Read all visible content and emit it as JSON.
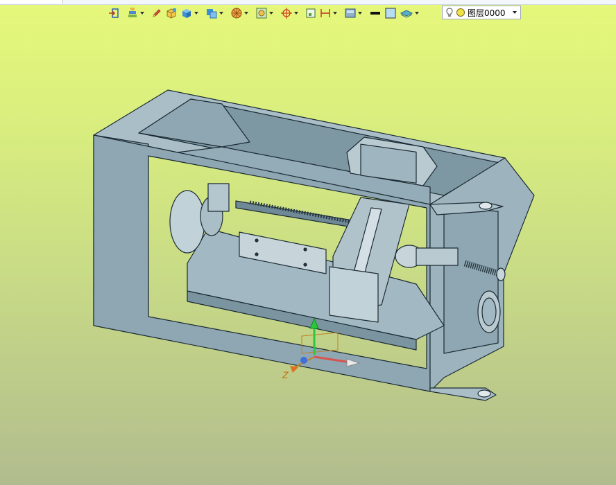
{
  "toolbar": {
    "items": [
      {
        "icon": "import-icon",
        "has_dropdown": false
      },
      {
        "icon": "layers-stack-icon",
        "has_dropdown": true
      },
      {
        "icon": "pencil-sketch-icon",
        "has_dropdown": false
      },
      {
        "icon": "extrude-icon",
        "has_dropdown": false
      },
      {
        "icon": "solid-box-icon",
        "has_dropdown": true
      },
      {
        "icon": "view-cube-icon",
        "has_dropdown": true
      },
      {
        "icon": "render-wheel-icon",
        "has_dropdown": true
      },
      {
        "icon": "display-frame-icon",
        "has_dropdown": true
      },
      {
        "icon": "snap-target-icon",
        "has_dropdown": true
      },
      {
        "icon": "grid-frame-icon",
        "has_dropdown": false
      },
      {
        "icon": "dimension-h-icon",
        "has_dropdown": true
      },
      {
        "icon": "visual-style-icon",
        "has_dropdown": true
      },
      {
        "icon": "line-weight-icon",
        "has_dropdown": false
      },
      {
        "icon": "fill-color-icon",
        "has_dropdown": false
      },
      {
        "icon": "layer-plane-icon",
        "has_dropdown": true
      }
    ],
    "layer": {
      "value": "图层0000"
    }
  },
  "triad": {
    "z_label": "Z"
  },
  "colors": {
    "model_fill": "#8ea7b2",
    "model_light": "#a9bec7",
    "model_dark": "#6f8a96",
    "edge": "#1b2a33",
    "axis_y": "#29c93a",
    "axis_x": "#d9534f",
    "axis_z": "#3f6fd8"
  }
}
